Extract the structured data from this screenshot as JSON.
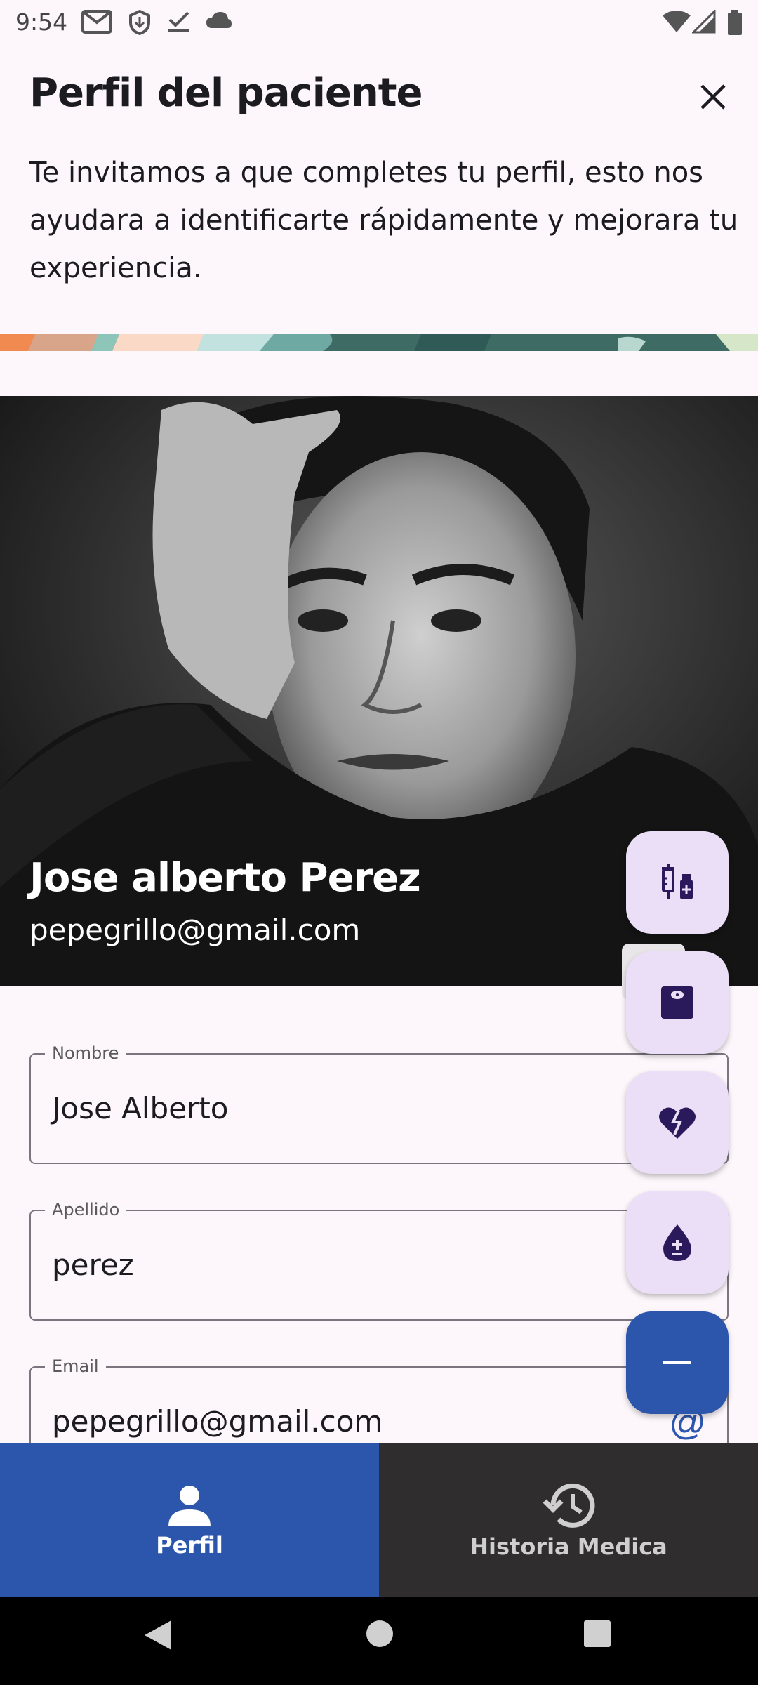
{
  "status_bar": {
    "time": "9:54",
    "left_icons": [
      "gmail-icon",
      "shield-download-icon",
      "check-download-icon",
      "cloud-icon"
    ],
    "right_icons": [
      "wifi-icon",
      "signal-icon",
      "battery-icon"
    ]
  },
  "header": {
    "title": "Perfil del paciente",
    "close_icon": "close-icon",
    "intro": "Te invitamos a que completes tu perfil, esto nos ayudara a identificarte rápidamente y mejorara tu experiencia."
  },
  "profile": {
    "name": "Jose alberto Perez",
    "email": "pepegrillo@gmail.com"
  },
  "form": {
    "nombre": {
      "label": "Nombre",
      "value": "Jose Alberto"
    },
    "apellido": {
      "label": "Apellido",
      "value": "perez"
    },
    "email": {
      "label": "Email",
      "value": "pepegrillo@gmail.com",
      "suffix_icon": "at-icon"
    }
  },
  "fabs": [
    {
      "icon": "vaccine-icon"
    },
    {
      "icon": "weight-scale-icon"
    },
    {
      "icon": "heart-broken-icon"
    },
    {
      "icon": "blood-drop-plus-minus-icon"
    },
    {
      "icon": "minus-icon"
    }
  ],
  "bottom_nav": {
    "items": [
      {
        "label": "Perfil",
        "icon": "person-icon",
        "active": true
      },
      {
        "label": "Historia Medica",
        "icon": "history-icon",
        "active": false
      }
    ]
  },
  "colors": {
    "primary": "#2b56ac",
    "fab_container": "#ebdff7",
    "fab_icon": "#2a1a5c",
    "background": "#fdf7fb"
  }
}
